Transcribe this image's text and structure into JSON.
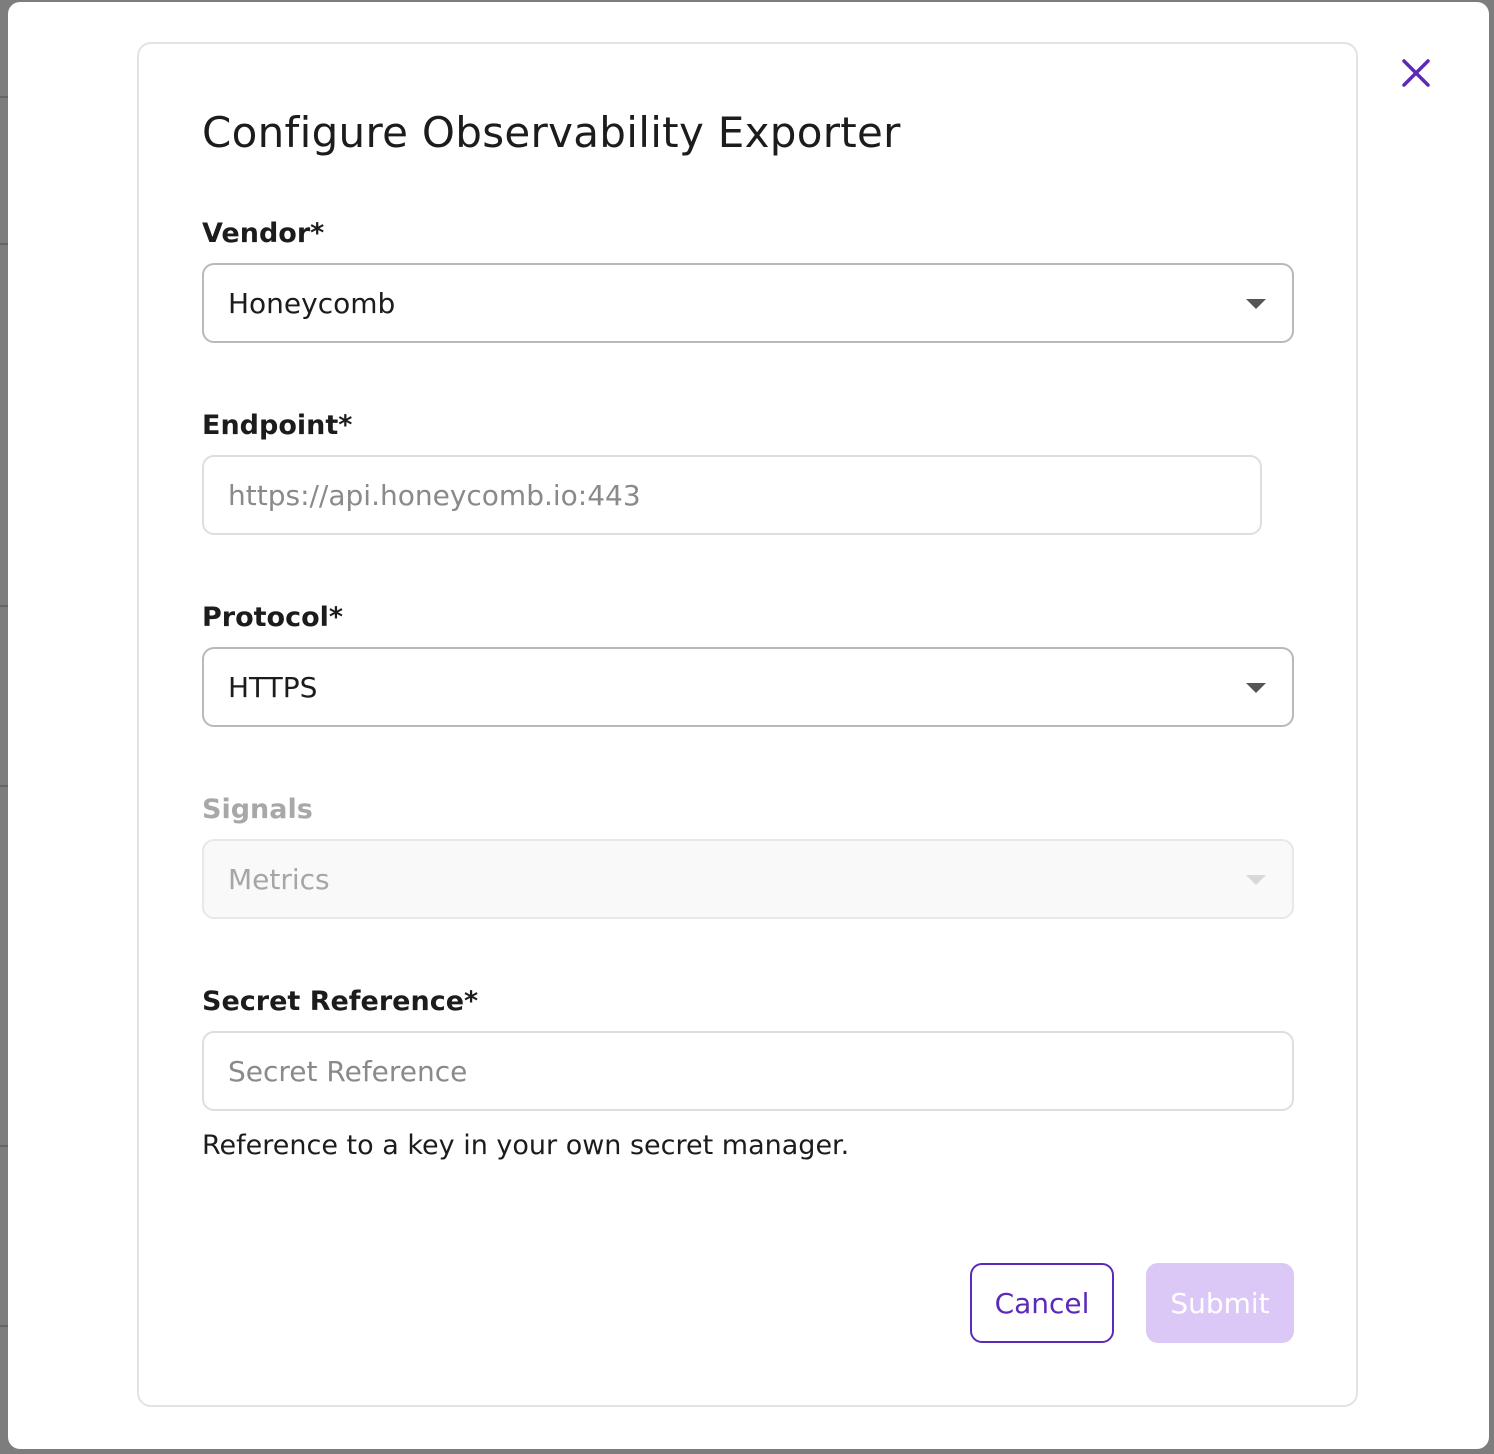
{
  "modal": {
    "title": "Configure Observability Exporter",
    "close_icon": "close-icon",
    "accent_color": "#5b2ab8"
  },
  "fields": {
    "vendor": {
      "label": "Vendor*",
      "value": "Honeycomb",
      "icon": "caret-down-icon"
    },
    "endpoint": {
      "label": "Endpoint*",
      "placeholder": "https://api.honeycomb.io:443"
    },
    "protocol": {
      "label": "Protocol*",
      "value": "HTTPS",
      "icon": "caret-down-icon"
    },
    "signals": {
      "label": "Signals",
      "value": "Metrics",
      "disabled": true,
      "icon": "caret-down-icon"
    },
    "secret_reference": {
      "label": "Secret Reference*",
      "placeholder": "Secret Reference",
      "helper": "Reference to a key in your own secret manager."
    }
  },
  "actions": {
    "cancel_label": "Cancel",
    "submit_label": "Submit",
    "submit_color": "#dcc8f6"
  }
}
